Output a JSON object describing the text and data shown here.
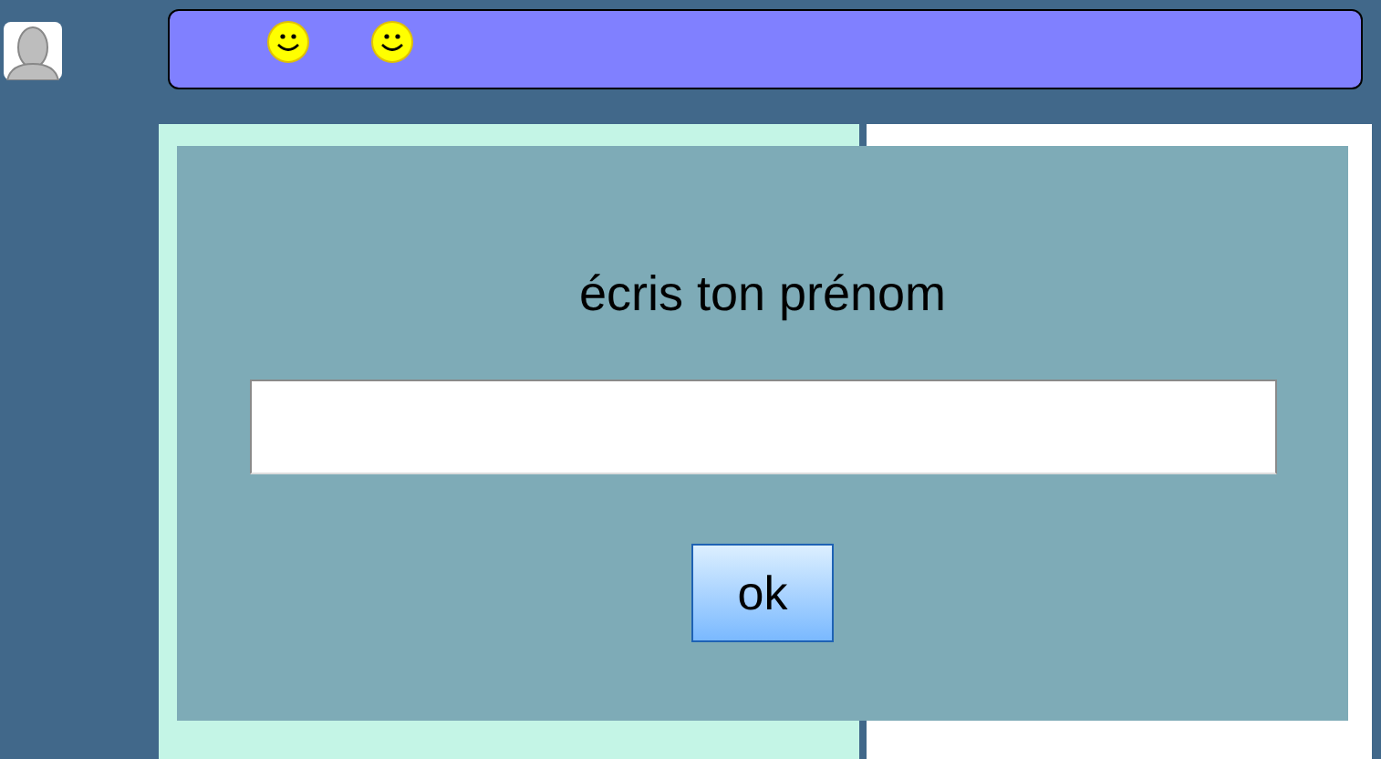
{
  "dialog": {
    "title": "écris ton prénom",
    "button": "ok"
  }
}
